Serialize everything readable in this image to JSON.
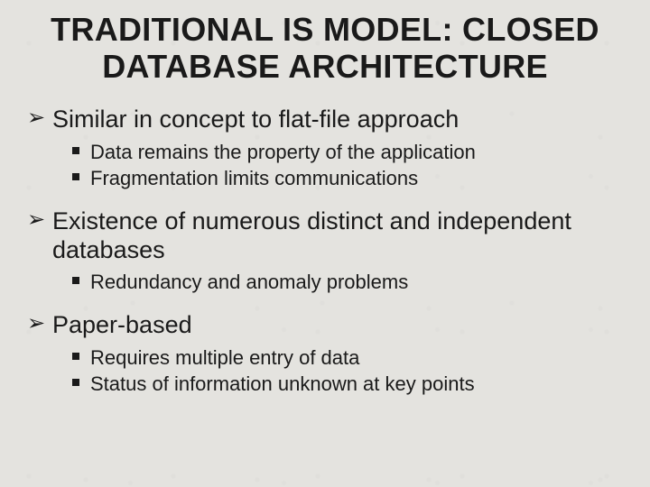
{
  "title": "TRADITIONAL IS MODEL: CLOSED DATABASE ARCHITECTURE",
  "bullets": [
    {
      "text": "Similar in concept to flat-file approach",
      "sub": [
        "Data remains the property of the application",
        "Fragmentation limits communications"
      ]
    },
    {
      "text": "Existence of numerous distinct and independent databases",
      "sub": [
        "Redundancy and anomaly problems"
      ]
    },
    {
      "text": "Paper-based",
      "sub": [
        "Requires multiple entry of data",
        "Status of information unknown at key points"
      ]
    }
  ]
}
